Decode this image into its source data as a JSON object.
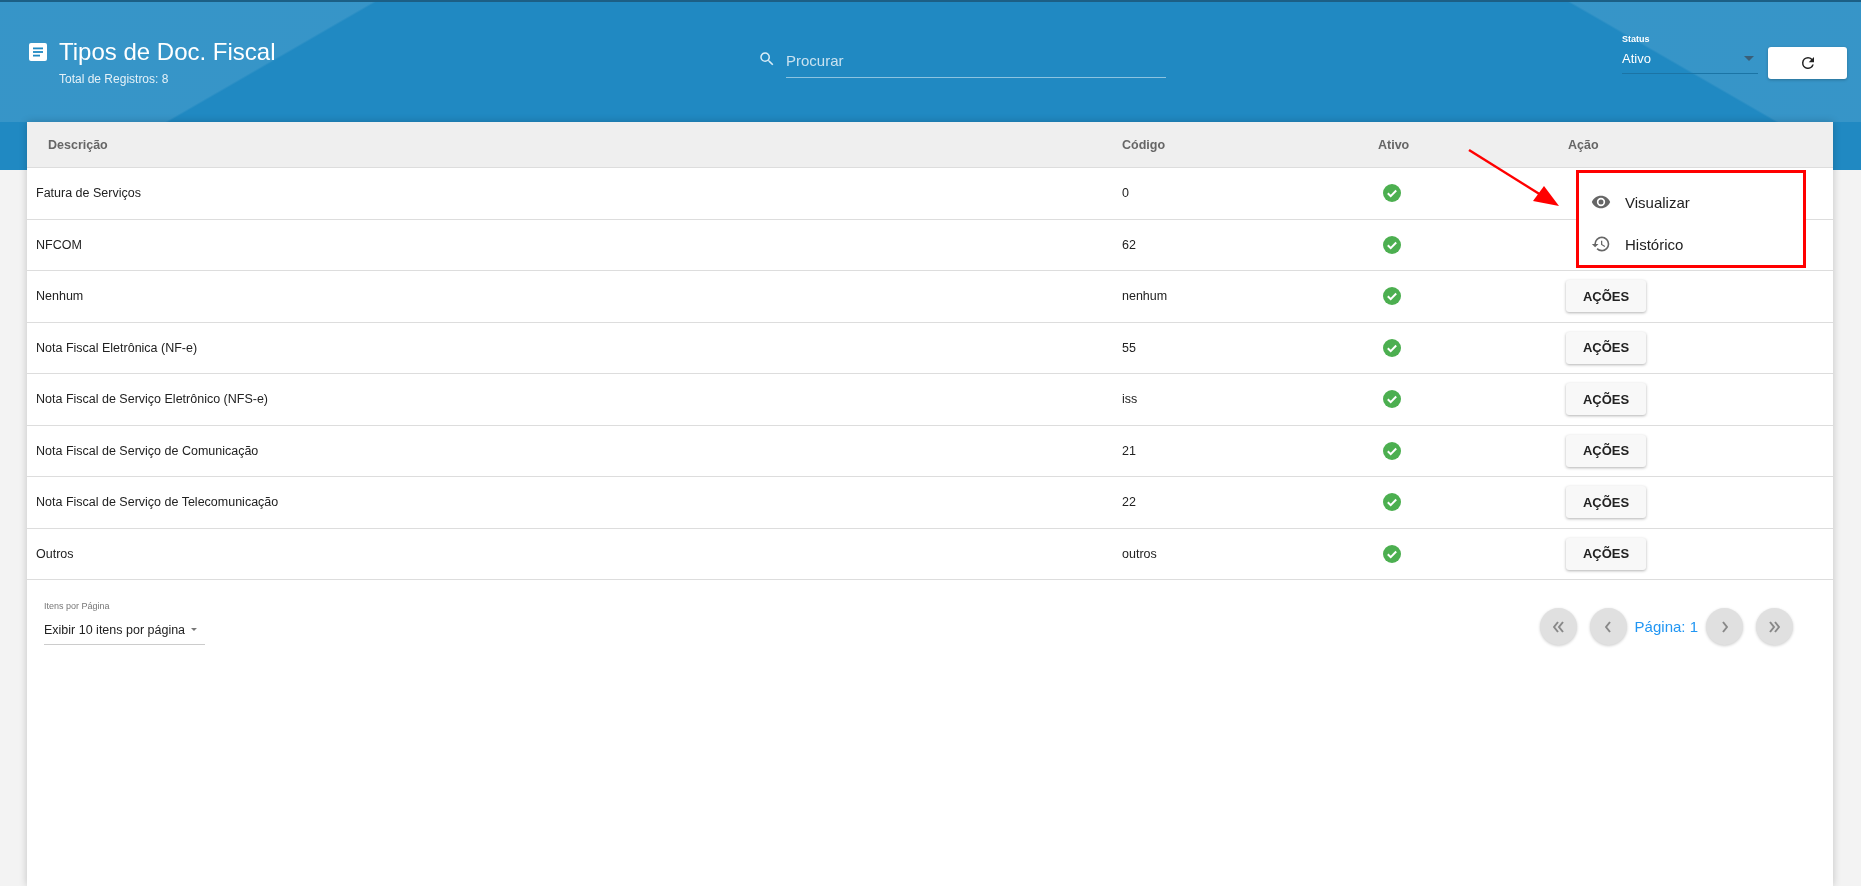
{
  "header": {
    "title": "Tipos de Doc. Fiscal",
    "subtitle": "Total de Registros: 8",
    "search": {
      "placeholder": "Procurar"
    },
    "status_filter": {
      "label": "Status",
      "value": "Ativo"
    }
  },
  "table": {
    "columns": [
      "Descrição",
      "Código",
      "Ativo",
      "Ação"
    ],
    "rows": [
      {
        "description": "Fatura de Serviços",
        "code": "0",
        "active": true
      },
      {
        "description": "NFCOM",
        "code": "62",
        "active": true
      },
      {
        "description": "Nenhum",
        "code": "nenhum",
        "active": true,
        "action": "AÇÕES"
      },
      {
        "description": "Nota Fiscal Eletrônica (NF-e)",
        "code": "55",
        "active": true,
        "action": "AÇÕES"
      },
      {
        "description": "Nota Fiscal de Serviço Eletrônico (NFS-e)",
        "code": "iss",
        "active": true,
        "action": "AÇÕES"
      },
      {
        "description": "Nota Fiscal de Serviço de Comunicação",
        "code": "21",
        "active": true,
        "action": "AÇÕES"
      },
      {
        "description": "Nota Fiscal de Serviço de Telecomunicação",
        "code": "22",
        "active": true,
        "action": "AÇÕES"
      },
      {
        "description": "Outros",
        "code": "outros",
        "active": true,
        "action": "AÇÕES"
      }
    ]
  },
  "action_menu": {
    "items": [
      {
        "label": "Visualizar",
        "kind": "eye"
      },
      {
        "label": "Histórico",
        "kind": "history"
      }
    ]
  },
  "footer": {
    "page_size": {
      "label": "Itens por Página",
      "value": "Exibir 10 itens por página"
    },
    "page_label": "Página: 1"
  }
}
